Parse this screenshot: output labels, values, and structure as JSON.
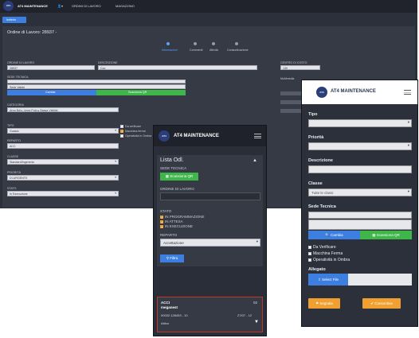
{
  "back": {
    "brand": "AT4 MAINTENANCE",
    "nav": [
      "ORDINI DI LAVORO",
      "MAGAZZINO"
    ],
    "tab_label": "Indietro",
    "title": "Ordine di Lavoro: 28937 -",
    "steps": [
      "Informazioni",
      "Commenti",
      "Attività",
      "Consuntivazione"
    ],
    "labels": {
      "ordine": "ORDINE DI LAVORO",
      "descrizione": "DESCRIZIONE",
      "centro": "CENTRO DI COSTO",
      "sede": "SEDE TECNICA",
      "categoria": "CATEGORIA",
      "tipo": "TIPO",
      "reparto": "REPARTO",
      "classe": "CLASSE",
      "priorita": "PRIORITÀ",
      "stato": "STATO",
      "da_verificare": "Da verificare",
      "macchina_ferma": "Macchina ferma",
      "operativita": "Operatività in Ombra",
      "multimedia": "Multimedia"
    },
    "values": {
      "ordine": "28937",
      "descrizione": "Cco",
      "centro": "130",
      "sede_placeholder": "Sede Valide",
      "categoria": "Area Bdi ▸ Linea Pulp ▸ Bassa Visibile",
      "tipo": "Guasto",
      "reparto": "ACC",
      "classe": "Standard/Ingeneria",
      "priorita": "DI-URGENTE",
      "stato": "In Esecuzione"
    },
    "buttons": {
      "cambia": "Cambia",
      "scansiona": "Scansiona QR"
    }
  },
  "phone": {
    "brand": "AT4 MAINTENANCE",
    "logo": "AT4",
    "title": "Lista Odl.",
    "sede_label": "SEDE TECNICA",
    "scan_button": "Scansiona QR",
    "ordine_label": "ORDINE DI LAVORO",
    "stato_label": "STATO",
    "stati": [
      "IN PROGRAMMAZIONE",
      "IN ATTESA",
      "IN ESECUZIONE"
    ],
    "reparto_label": "REPARTO",
    "reparto_value": "Accettazione",
    "filter_button": "Filtra",
    "card": {
      "title": "ACCI",
      "badge": "02",
      "subtitle": "meganest",
      "code": "00032.128453 - 10",
      "date": "27/07 - 12",
      "status": "Attivo"
    }
  },
  "right": {
    "brand": "AT4 MAINTENANCE",
    "logo": "AT4",
    "fields": {
      "tipo": "Tipo",
      "priorita": "Priorità",
      "descrizione": "Descrizione",
      "classe": "Classe",
      "classe_value": "Tutte le classi",
      "sede": "Sede Tecnica"
    },
    "buttons": {
      "cambia": "Cambia",
      "scansiona": "Scansiona QR"
    },
    "checks": [
      "Da Verificare",
      "Macchina Ferma",
      "Operatività in Ombra"
    ],
    "allegato_label": "Allegato",
    "file_button": "Select File",
    "bottom": {
      "segnala": "Segnala",
      "consuntiva": "Consuntiva"
    }
  },
  "colors": {
    "green": "#3fb64a",
    "blue": "#3d7fe0",
    "orange": "#f0a030",
    "red_border": "#c0392b",
    "dark": "#2c303a"
  }
}
